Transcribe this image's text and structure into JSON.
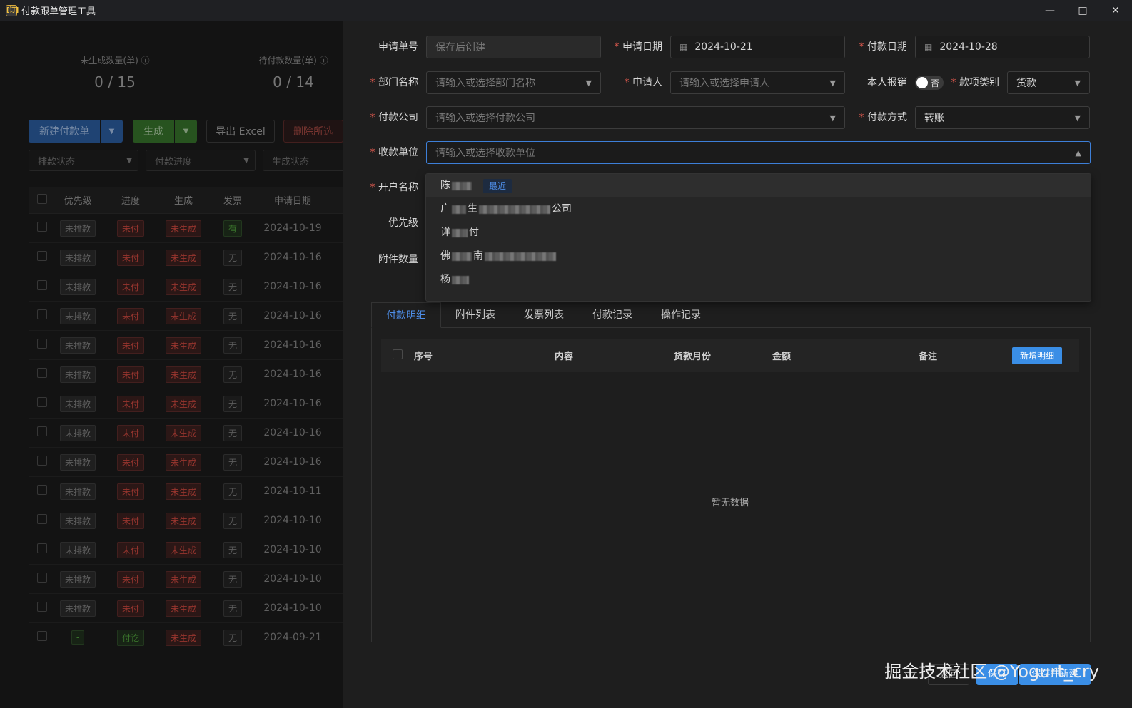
{
  "window": {
    "title": "付款跟单管理工具",
    "icon_text": "[订]"
  },
  "stats": [
    {
      "label": "未生成数量(单)",
      "value": "0 / 15"
    },
    {
      "label": "待付款数量(单)",
      "value": "0 / 14"
    }
  ],
  "toolbar": {
    "new_label": "新建付款单",
    "gen_label": "生成",
    "export_label": "导出 Excel",
    "delete_label": "删除所选"
  },
  "filters": {
    "arrange": "排款状态",
    "progress": "付款进度",
    "generate": "生成状态"
  },
  "table": {
    "headers": [
      "优先级",
      "进度",
      "生成",
      "发票",
      "申请日期"
    ],
    "rows": [
      {
        "priority": "未排款",
        "progress": "未付",
        "generate": "未生成",
        "invoice": "有",
        "date": "2024-10-19"
      },
      {
        "priority": "未排款",
        "progress": "未付",
        "generate": "未生成",
        "invoice": "无",
        "date": "2024-10-16"
      },
      {
        "priority": "未排款",
        "progress": "未付",
        "generate": "未生成",
        "invoice": "无",
        "date": "2024-10-16"
      },
      {
        "priority": "未排款",
        "progress": "未付",
        "generate": "未生成",
        "invoice": "无",
        "date": "2024-10-16"
      },
      {
        "priority": "未排款",
        "progress": "未付",
        "generate": "未生成",
        "invoice": "无",
        "date": "2024-10-16"
      },
      {
        "priority": "未排款",
        "progress": "未付",
        "generate": "未生成",
        "invoice": "无",
        "date": "2024-10-16"
      },
      {
        "priority": "未排款",
        "progress": "未付",
        "generate": "未生成",
        "invoice": "无",
        "date": "2024-10-16"
      },
      {
        "priority": "未排款",
        "progress": "未付",
        "generate": "未生成",
        "invoice": "无",
        "date": "2024-10-16"
      },
      {
        "priority": "未排款",
        "progress": "未付",
        "generate": "未生成",
        "invoice": "无",
        "date": "2024-10-16"
      },
      {
        "priority": "未排款",
        "progress": "未付",
        "generate": "未生成",
        "invoice": "无",
        "date": "2024-10-11"
      },
      {
        "priority": "未排款",
        "progress": "未付",
        "generate": "未生成",
        "invoice": "无",
        "date": "2024-10-10"
      },
      {
        "priority": "未排款",
        "progress": "未付",
        "generate": "未生成",
        "invoice": "无",
        "date": "2024-10-10"
      },
      {
        "priority": "未排款",
        "progress": "未付",
        "generate": "未生成",
        "invoice": "无",
        "date": "2024-10-10"
      },
      {
        "priority": "未排款",
        "progress": "未付",
        "generate": "未生成",
        "invoice": "无",
        "date": "2024-10-10"
      },
      {
        "priority": "-",
        "progress": "付讫",
        "generate": "未生成",
        "invoice": "无",
        "date": "2024-09-21"
      }
    ]
  },
  "form": {
    "apply_no": {
      "label": "申请单号",
      "placeholder": "保存后创建"
    },
    "apply_date": {
      "label": "申请日期",
      "value": "2024-10-21"
    },
    "pay_date": {
      "label": "付款日期",
      "value": "2024-10-28"
    },
    "dept": {
      "label": "部门名称",
      "placeholder": "请输入或选择部门名称"
    },
    "applicant": {
      "label": "申请人",
      "placeholder": "请输入或选择申请人"
    },
    "self_reimburse": {
      "label": "本人报销",
      "toggle": "否"
    },
    "pay_type": {
      "label": "款项类别",
      "value": "货款"
    },
    "pay_company": {
      "label": "付款公司",
      "placeholder": "请输入或选择付款公司"
    },
    "pay_method": {
      "label": "付款方式",
      "value": "转账"
    },
    "payee": {
      "label": "收款单位",
      "placeholder": "请输入或选择收款单位"
    },
    "account_name": {
      "label": "开户名称"
    },
    "priority": {
      "label": "优先级"
    },
    "attachments": {
      "label": "附件数量"
    }
  },
  "dropdown": {
    "recent_tag": "最近",
    "items": [
      {
        "prefix": "陈",
        "suffix": ""
      },
      {
        "prefix": "广",
        "mid": "生",
        "suffix": "公司"
      },
      {
        "prefix": "详",
        "suffix": "付"
      },
      {
        "prefix": "佛",
        "mid": "南",
        "suffix": ""
      },
      {
        "prefix": "杨",
        "suffix": ""
      }
    ]
  },
  "tabs": [
    "付款明细",
    "附件列表",
    "发票列表",
    "付款记录",
    "操作记录"
  ],
  "detail": {
    "headers": [
      "序号",
      "内容",
      "货款月份",
      "金额",
      "备注"
    ],
    "add_label": "新增明细",
    "empty": "暂无数据"
  },
  "footer": {
    "cancel": "返回",
    "save": "保存",
    "save_new": "保存并新建"
  },
  "watermark": "掘金技术社区 @Yogurt_cry"
}
